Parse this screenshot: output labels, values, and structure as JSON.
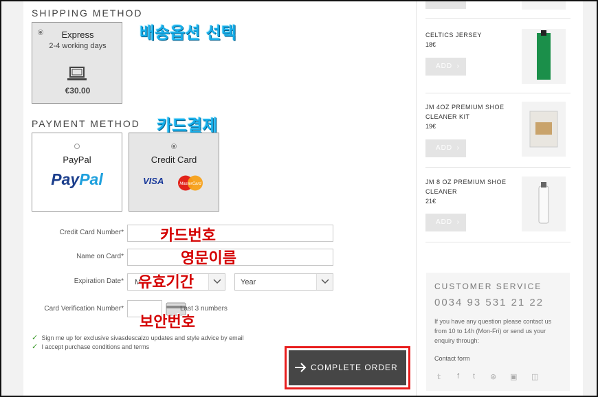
{
  "shipping": {
    "title": "SHIPPING METHOD",
    "annotation": "배송옵션 선택",
    "option": {
      "name": "Express",
      "days": "2-4 working days",
      "price": "€30.00",
      "icon": "laptop-icon"
    }
  },
  "payment": {
    "title": "PAYMENT METHOD",
    "annotation": "카드결제",
    "options": [
      {
        "label": "PayPal",
        "logo_pay": "Pay",
        "logo_pal": "Pal",
        "selected": false
      },
      {
        "label": "Credit Card",
        "logo_visa": "VISA",
        "logo_mc": "MasterCard",
        "selected": true
      }
    ]
  },
  "form": {
    "card_number_label": "Credit Card Number*",
    "card_number_annotation": "카드번호",
    "name_label": "Name on Card*",
    "name_annotation": "영문이름",
    "expiration_label": "Expiration Date*",
    "expiration_annotation": "유효기간",
    "month_value": "M",
    "year_value": "Year",
    "cvv_label": "Card Verification Number*",
    "cvv_hint": "Last 3 numbers",
    "cvv_annotation": "보안번호"
  },
  "checkboxes": [
    {
      "label": "Sign me up for exclusive sivasdescalzo updates and style advice by email",
      "checked": true
    },
    {
      "label": "I accept purchase conditions and terms",
      "checked": true
    }
  ],
  "complete_order": {
    "label": "COMPLETE ORDER",
    "highlight_color": "#e81d1d"
  },
  "cart": {
    "add_label": "ADD",
    "items": [
      {
        "name_lines": [
          "CELTICS JERSEY"
        ],
        "price": "18€"
      },
      {
        "name_lines": [
          "JM 4OZ PREMIUM SHOE",
          "CLEANER KIT"
        ],
        "price": "19€"
      },
      {
        "name_lines": [
          "JM 8 OZ PREMIUM SHOE",
          "CLEANER"
        ],
        "price": "21€"
      }
    ]
  },
  "customer_service": {
    "title": "CUSTOMER SERVICE",
    "phone": "0034 93 531 21 22",
    "text": "If you have any question please contact us from 10 to 14h (Mon-Fri) or send us your enquiry through:",
    "contact_link": "Contact form",
    "social_icons": [
      "twitter-icon",
      "facebook-icon",
      "tumblr-icon",
      "pinterest-icon",
      "googleplus-icon",
      "instagram-icon"
    ]
  }
}
